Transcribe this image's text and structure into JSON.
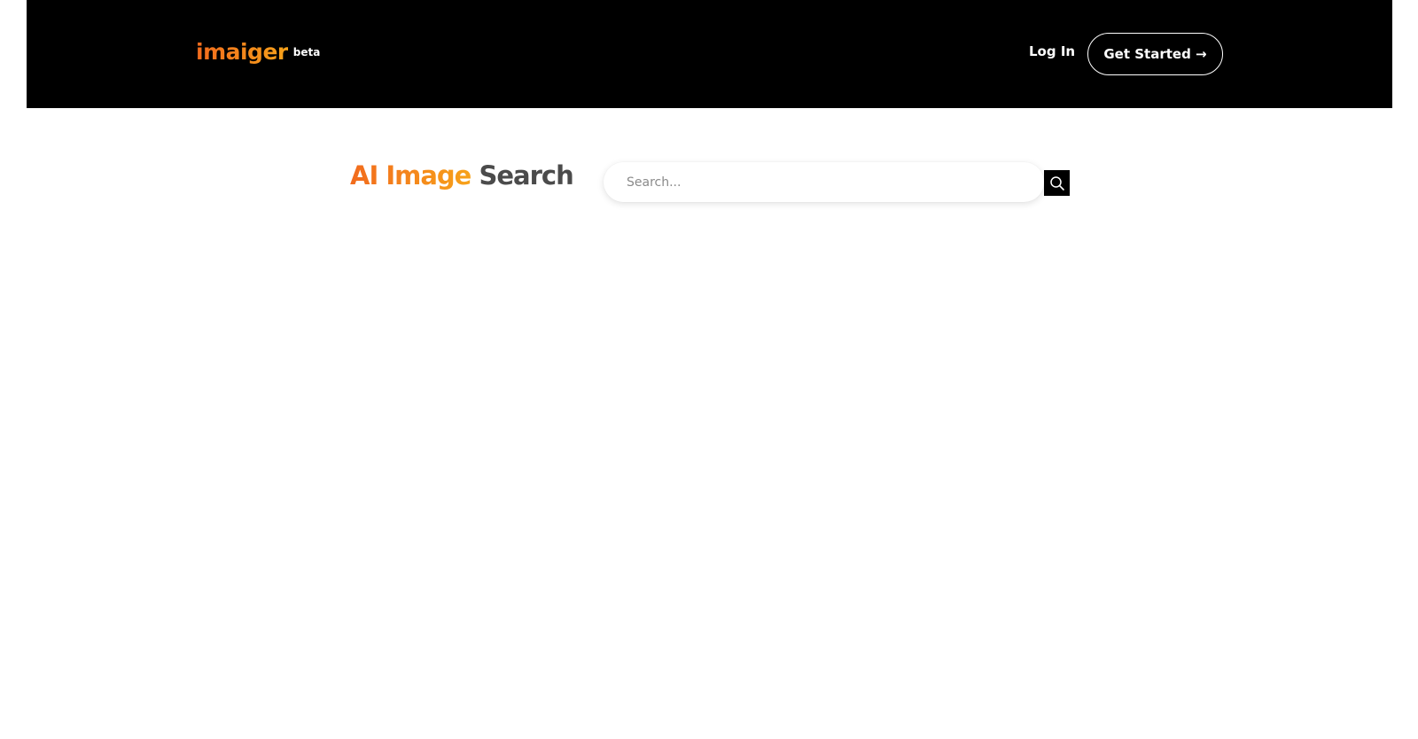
{
  "header": {
    "brand": {
      "name": "imaiger",
      "tag": "beta"
    },
    "nav": {
      "login_label": "Log In",
      "cta_label": "Get Started →"
    }
  },
  "hero": {
    "title_accent": "AI Image",
    "title_rest": "Search"
  },
  "search": {
    "placeholder": "Search...",
    "value": "",
    "button_icon": "search-icon"
  },
  "colors": {
    "navbar_bg": "#000000",
    "accent_start": "#f26b1d",
    "accent_end": "#f7a21a",
    "title_gray": "#4b4b4b"
  }
}
